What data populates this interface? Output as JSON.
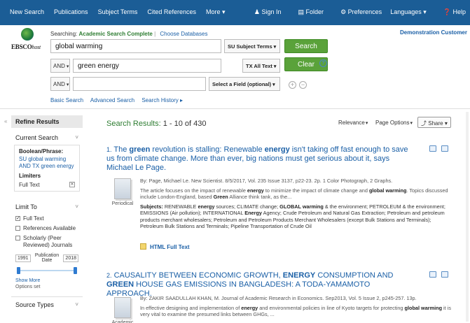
{
  "topnav": {
    "items": [
      "New Search",
      "Publications",
      "Subject Terms",
      "Cited References",
      "More ▾"
    ],
    "right": [
      "Sign In",
      "Folder",
      "Preferences",
      "Languages ▾",
      "Help"
    ]
  },
  "brand": {
    "logo_word": "EBSCO",
    "logo_host": "host"
  },
  "search": {
    "searching_label": "Searching:",
    "database": "Academic Search Complete",
    "choose_db": "Choose Databases",
    "demo": "Demonstration Customer",
    "rows": [
      {
        "bool": "",
        "term": "global warming",
        "field": "SU Subject Terms"
      },
      {
        "bool": "AND",
        "term": "green energy",
        "field": "TX All Text"
      },
      {
        "bool": "AND",
        "term": "",
        "field": "Select a Field (optional)"
      }
    ],
    "search_btn": "Search",
    "clear_btn": "Clear",
    "help_glyph": "?",
    "add_glyph": "+",
    "remove_glyph": "−",
    "links": [
      "Basic Search",
      "Advanced Search",
      "Search History ▸"
    ]
  },
  "sidebar": {
    "collapse": "«",
    "refine": "Refine Results",
    "current_search": "Current Search",
    "boolean_label": "Boolean/Phrase:",
    "boolean_query": "SU global warming AND TX green energy",
    "limiters_label": "Limiters",
    "limiter_value": "Full Text",
    "remove_glyph": "✕",
    "limit_to": "Limit To",
    "checkboxes": [
      {
        "label": "Full Text",
        "checked": true
      },
      {
        "label": "References Available",
        "checked": false
      },
      {
        "label": "Scholarly (Peer Reviewed) Journals",
        "checked": false
      }
    ],
    "date_from": "1991",
    "date_label": "Publication Date",
    "date_to": "2018",
    "show_more": "Show More",
    "options_set": "Options set",
    "source_types": "Source Types"
  },
  "results": {
    "label": "Search Results:",
    "range": "1 - 10 of 430",
    "relevance": "Relevance",
    "page_options": "Page Options",
    "share": "Share",
    "items": [
      {
        "num": "1.",
        "title_segments": [
          {
            "text": "The ",
            "bold": false
          },
          {
            "text": "green",
            "bold": true
          },
          {
            "text": " revolution is stalling: Renewable ",
            "bold": false
          },
          {
            "text": "energy",
            "bold": true
          },
          {
            "text": " isn't taking off fast enough to save us from climate change. More than ever, big nations must get serious about it, says Michael Le Page.",
            "bold": false
          }
        ],
        "type": "Periodical",
        "source": "By: Page, Michael Le. New Scientist. 8/5/2017, Vol. 235 Issue 3137, p22-23. 2p. 1 Color Photograph, 2 Graphs.",
        "abstract_segments": [
          {
            "text": "The article focuses on the impact of renewable ",
            "bold": false
          },
          {
            "text": "energy",
            "bold": true
          },
          {
            "text": " to minimize the impact of climate change and ",
            "bold": false
          },
          {
            "text": "global warming",
            "bold": true
          },
          {
            "text": ". Topics discussed include London-England, based ",
            "bold": false
          },
          {
            "text": "Green",
            "bold": true
          },
          {
            "text": " Alliance think tank, as the...",
            "bold": false
          }
        ],
        "subjects_segments": [
          {
            "text": "Subjects: ",
            "bold": true
          },
          {
            "text": "RENEWABLE ",
            "bold": false
          },
          {
            "text": "energy",
            "bold": true
          },
          {
            "text": " sources; CLIMATE change; ",
            "bold": false
          },
          {
            "text": "GLOBAL warming",
            "bold": true
          },
          {
            "text": " & the environment; PETROLEUM & the environment; EMISSIONS (Air pollution); INTERNATIONAL ",
            "bold": false
          },
          {
            "text": "Energy",
            "bold": true
          },
          {
            "text": " Agency; Crude Petroleum and Natural Gas Extraction; Petroleum and petroleum products merchant wholesalers; Petroleum and Petroleum Products Merchant Wholesalers (except Bulk Stations and Terminals); Petroleum Bulk Stations and Terminals; Pipeline Transportation of Crude Oil",
            "bold": false
          }
        ],
        "full_text": "HTML Full Text"
      },
      {
        "num": "2.",
        "title_segments": [
          {
            "text": "CAUSALITY BETWEEN ECONOMIC GROWTH, ",
            "bold": false
          },
          {
            "text": "ENERGY",
            "bold": true
          },
          {
            "text": " CONSUMPTION AND ",
            "bold": false
          },
          {
            "text": "GREEN",
            "bold": true
          },
          {
            "text": " HOUSE GAS EMISSIONS IN BANGLADESH: A TODA-YAMAMOTO APPROACH.",
            "bold": false
          }
        ],
        "type": "Academic",
        "source": "By: ZAKIR SAADULLAH KHAN, M. Journal of Academic Research in Economics. Sep2013, Vol. 5 Issue 2, p245-257. 13p.",
        "abstract_segments": [
          {
            "text": "In effective designing and implementation of ",
            "bold": false
          },
          {
            "text": "energy",
            "bold": true
          },
          {
            "text": " and environmental policies in line of Kyoto targets for protecting ",
            "bold": false
          },
          {
            "text": "global warming",
            "bold": true
          },
          {
            "text": " it is very vital to examine the presumed links between GHGs, ...",
            "bold": false
          }
        ]
      }
    ]
  }
}
